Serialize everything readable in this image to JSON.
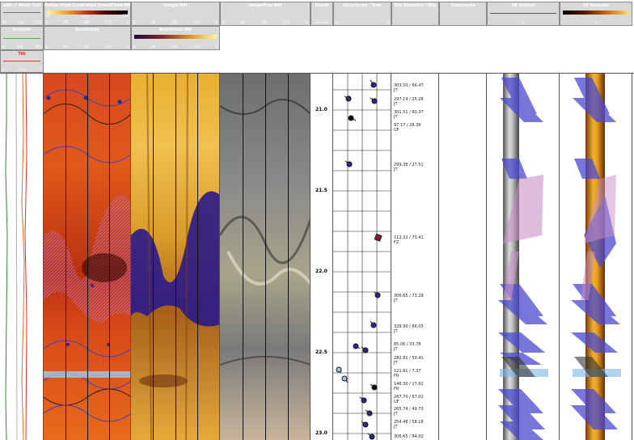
{
  "headers": {
    "tension": {
      "title": "adic + Mech Cali",
      "scale": [
        "80",
        "mm",
        "270"
      ]
    },
    "ratios": {
      "title": "Ratios from Controlled TravelTime-NM",
      "scale_a": [
        "93",
        "mm",
        "270"
      ],
      "scale_b": [
        "0",
        "90",
        "180",
        "270",
        "0"
      ]
    },
    "image_nm": {
      "title": "Image-NM",
      "scale": [
        "0",
        "90",
        "180",
        "270",
        "0"
      ]
    },
    "imageproc_nm": {
      "title": "ImageProc-NM",
      "scale": [
        "0",
        "90",
        "180",
        "270",
        "0"
      ]
    },
    "depth": {
      "title": "Depth",
      "unit": "1m:50m"
    },
    "structures_true": {
      "title": "Structures - True",
      "scale": [
        "0",
        "4"
      ]
    },
    "dip_dir": {
      "title": "Dip Direction / Dip"
    },
    "comments": {
      "title": "Comments"
    },
    "optical_3d": {
      "title": "3D Optical",
      "scale": [
        "",
        "4"
      ]
    },
    "acoustic_3d": {
      "title": "3D Acoustic",
      "scale": [
        "",
        "1"
      ]
    },
    "azimuth": {
      "title": "Azimuth",
      "scale": [
        "0",
        "deg",
        "360"
      ]
    },
    "structures": {
      "title": "Structures",
      "scale": [
        "0",
        "90",
        "180",
        "270",
        "0"
      ]
    },
    "amplitude_nm": {
      "title": "Amplitude-NM",
      "scale": [
        "0",
        "90",
        "180",
        "270",
        "0"
      ]
    },
    "tilt": {
      "title": "Tilt",
      "scale": [
        "0",
        "deg",
        "5"
      ]
    }
  },
  "depth_ticks": [
    "21.0",
    "21.5",
    "22.0",
    "22.5",
    "23.0"
  ],
  "dips": [
    {
      "value": "303.50 / 66.47",
      "type": "JT"
    },
    {
      "value": "297.19 / 25.28",
      "type": "JT"
    },
    {
      "value": "301.51 / 60.37",
      "type": "JT"
    },
    {
      "value": "97.17 / 28.39",
      "type": "UF"
    },
    {
      "value": "299.36 / 27.51",
      "type": "JT"
    },
    {
      "value": "112.32 / 73.41",
      "type": "FZ"
    },
    {
      "value": "306.65 / 73.28",
      "type": "JT"
    },
    {
      "value": "329.90 / 66.05",
      "type": "JT"
    },
    {
      "value": "85.06 / 33.78",
      "type": "JT"
    },
    {
      "value": "282.81 / 50.41",
      "type": "JT"
    },
    {
      "value": "121.61 / 7.37",
      "type": "FR"
    },
    {
      "value": "146.30 / 17.62",
      "type": "FR"
    },
    {
      "value": "267.70 / 67.02",
      "type": "UF"
    },
    {
      "value": "265.74 / 49.73",
      "type": "JT"
    },
    {
      "value": "254.48 / 58.18",
      "type": "JT"
    },
    {
      "value": "306.65 / 84.02",
      "type": ""
    }
  ],
  "colors": {
    "header_bg": "#d9d9d9",
    "structure_line": "#3a3ab8",
    "fz_marker": "#8b1a3a"
  }
}
